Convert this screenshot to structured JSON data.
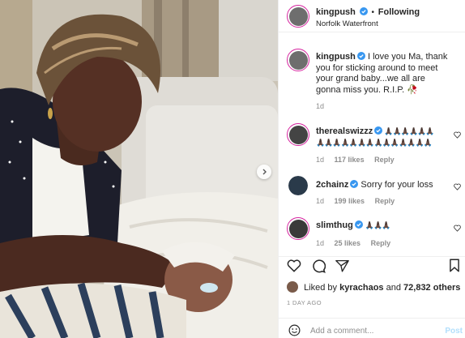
{
  "post": {
    "author": "kingpush",
    "follow_dot": "•",
    "follow_status": "Following",
    "location": "Norfolk Waterfront",
    "caption": "I love you Ma, thank you for sticking around to meet your grand baby...we all are gonna miss you. R.I.P.",
    "caption_emoji": "🥀",
    "caption_age": "1d"
  },
  "comments": [
    {
      "username": "therealswizzz",
      "text": "🙏🏿🙏🏿🙏🏿🙏🏿🙏🏿🙏🏿🙏🏿🙏🏿🙏🏿🙏🏿🙏🏿🙏🏿🙏🏿🙏🏿🙏🏿🙏🏿🙏🏿🙏🏿🙏🏿🙏🏿🙏🏿🙏🏿",
      "age": "1d",
      "likes": "117 likes",
      "reply": "Reply"
    },
    {
      "username": "2chainz",
      "text": "Sorry for your loss",
      "age": "1d",
      "likes": "199 likes",
      "reply": "Reply"
    },
    {
      "username": "slimthug",
      "text": "🙏🏿🙏🏿🙏🏿",
      "age": "1d",
      "likes": "25 likes",
      "reply": "Reply"
    }
  ],
  "likes": {
    "prefix": "Liked by",
    "user": "kyrachaos",
    "connector": "and",
    "count": "72,832 others"
  },
  "timestamp": "1 DAY AGO",
  "add_comment": {
    "placeholder": "Add a comment...",
    "post": "Post"
  },
  "icons": {
    "like": "heart-icon",
    "comment": "comment-icon",
    "share": "paper-plane-icon",
    "save": "bookmark-icon",
    "emoji": "smiley-icon",
    "verified": "verified-badge-icon",
    "next": "chevron-right-icon"
  },
  "colors": {
    "verified": "#3897f0",
    "story_ring": "#d6249f",
    "muted": "#8e8e8e",
    "post_disabled": "#b2dffc"
  }
}
